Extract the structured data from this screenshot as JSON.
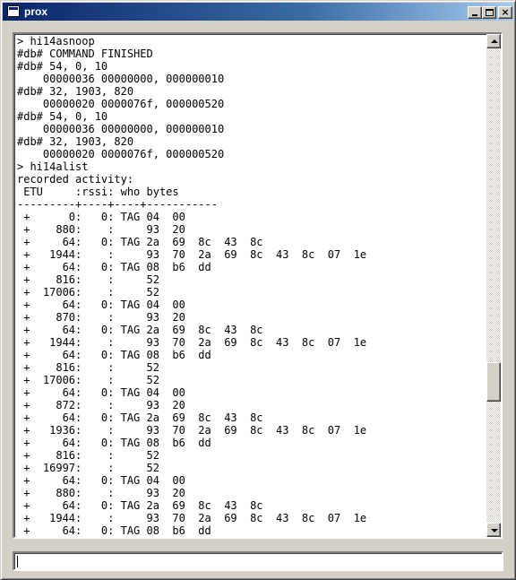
{
  "window": {
    "title": "prox"
  },
  "console": {
    "lines": [
      "> hi14asnoop",
      "#db# COMMAND FINISHED",
      "#db# 54, 0, 10",
      "    00000036 00000000, 000000010",
      "#db# 32, 1903, 820",
      "    00000020 0000076f, 000000520",
      "#db# 54, 0, 10",
      "    00000036 00000000, 000000010",
      "#db# 32, 1903, 820",
      "    00000020 0000076f, 000000520",
      "> hi14alist",
      "recorded activity:",
      " ETU     :rssi: who bytes",
      "---------+----+----+-----------",
      " +      0:   0: TAG 04  00",
      " +    880:    :     93  20",
      " +     64:   0: TAG 2a  69  8c  43  8c",
      " +   1944:    :     93  70  2a  69  8c  43  8c  07  1e",
      " +     64:   0: TAG 08  b6  dd",
      " +    816:    :     52",
      " +  17006:    :     52",
      " +     64:   0: TAG 04  00",
      " +    870:    :     93  20",
      " +     64:   0: TAG 2a  69  8c  43  8c",
      " +   1944:    :     93  70  2a  69  8c  43  8c  07  1e",
      " +     64:   0: TAG 08  b6  dd",
      " +    816:    :     52",
      " +  17006:    :     52",
      " +     64:   0: TAG 04  00",
      " +    872:    :     93  20",
      " +     64:   0: TAG 2a  69  8c  43  8c",
      " +   1936:    :     93  70  2a  69  8c  43  8c  07  1e",
      " +     64:   0: TAG 08  b6  dd",
      " +    816:    :     52",
      " +  16997:    :     52",
      " +     64:   0: TAG 04  00",
      " +    880:    :     93  20",
      " +     64:   0: TAG 2a  69  8c  43  8c",
      " +   1944:    :     93  70  2a  69  8c  43  8c  07  1e",
      " +     64:   0: TAG 08  b6  dd"
    ]
  },
  "input": {
    "value": ""
  },
  "icons": {
    "app": "app-window-icon",
    "minimize": "minimize-icon",
    "maximize": "maximize-icon",
    "close": "close-icon",
    "scroll_up": "arrow-up-icon",
    "scroll_down": "arrow-down-icon"
  },
  "colors": {
    "titlebar_start": "#0a246a",
    "titlebar_end": "#a6caf0",
    "face": "#d4d0c8"
  }
}
